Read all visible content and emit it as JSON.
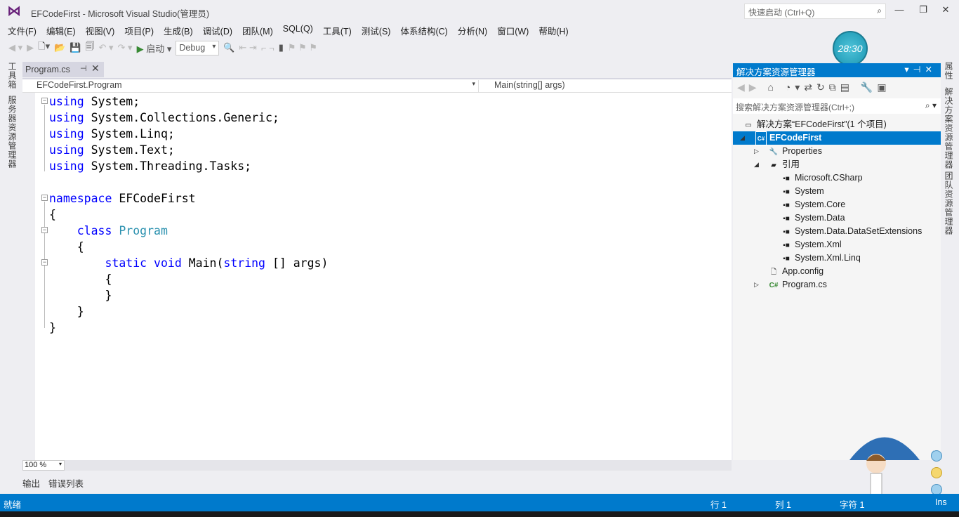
{
  "window": {
    "title": "EFCodeFirst - Microsoft Visual Studio(管理员)",
    "quick_launch_placeholder": "快速启动 (Ctrl+Q)"
  },
  "menu": [
    "文件(F)",
    "编辑(E)",
    "视图(V)",
    "项目(P)",
    "生成(B)",
    "调试(D)",
    "团队(M)",
    "SQL(Q)",
    "工具(T)",
    "测试(S)",
    "体系结构(C)",
    "分析(N)",
    "窗口(W)",
    "帮助(H)"
  ],
  "toolbar": {
    "start_label": "启动",
    "config": "Debug"
  },
  "timer": "28:30",
  "left_strip": {
    "toolbox": "工具箱",
    "server_explorer": "服务器资源管理器"
  },
  "right_strip": {
    "properties": "属性",
    "solution_explorer": "解决方案资源管理器",
    "team_explorer": "团队资源管理器"
  },
  "editor": {
    "tab": "Program.cs",
    "nav_type": "EFCodeFirst.Program",
    "nav_member": "Main(string[] args)",
    "zoom": "100 %",
    "lines": [
      [
        [
          "kw",
          "using"
        ],
        [
          "",
          "System;"
        ]
      ],
      [
        [
          "kw",
          "using"
        ],
        [
          "",
          "System.Collections.Generic;"
        ]
      ],
      [
        [
          "kw",
          "using"
        ],
        [
          "",
          "System.Linq;"
        ]
      ],
      [
        [
          "kw",
          "using"
        ],
        [
          "",
          "System.Text;"
        ]
      ],
      [
        [
          "kw",
          "using"
        ],
        [
          "",
          "System.Threading.Tasks;"
        ]
      ],
      [],
      [
        [
          "kw",
          "namespace"
        ],
        [
          "",
          "EFCodeFirst"
        ]
      ],
      [
        [
          "",
          "{"
        ]
      ],
      [
        [
          "",
          "    "
        ],
        [
          "kw",
          "class"
        ],
        [
          "ty",
          "Program"
        ]
      ],
      [
        [
          "",
          "    {"
        ]
      ],
      [
        [
          "",
          "        "
        ],
        [
          "kw",
          "static"
        ],
        [
          "kw",
          "void"
        ],
        [
          "",
          "Main("
        ],
        [
          "kw",
          "string"
        ],
        [
          "",
          "[] args)"
        ]
      ],
      [
        [
          "",
          "        {"
        ]
      ],
      [
        [
          "",
          "        }"
        ]
      ],
      [
        [
          "",
          "    }"
        ]
      ],
      [
        [
          "",
          "}"
        ]
      ]
    ]
  },
  "bottom_tabs": [
    "输出",
    "错误列表"
  ],
  "status": {
    "ready": "就绪",
    "line": "行 1",
    "col": "列 1",
    "char": "字符 1",
    "mode": "Ins"
  },
  "solution_explorer": {
    "title": "解决方案资源管理器",
    "search_placeholder": "搜索解决方案资源管理器(Ctrl+;)",
    "solution": "解决方案“EFCodeFirst”(1 个项目)",
    "project": "EFCodeFirst",
    "properties": "Properties",
    "references": "引用",
    "refs": [
      "Microsoft.CSharp",
      "System",
      "System.Core",
      "System.Data",
      "System.Data.DataSetExtensions",
      "System.Xml",
      "System.Xml.Linq"
    ],
    "app_config": "App.config",
    "program": "Program.cs"
  }
}
